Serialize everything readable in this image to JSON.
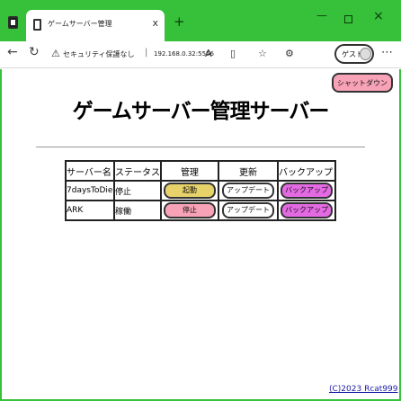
{
  "browser": {
    "tab_title": "ゲームサーバー管理",
    "tab_close": "x",
    "new_tab": "+",
    "window_controls": {
      "minimize": "—",
      "close": "×"
    },
    "address": {
      "security_warning": "セキュリティ保護なし",
      "separator": "|",
      "url": "192.168.0.32:5556"
    },
    "profile_label": "ゲスト",
    "icons": [
      "back-arrow",
      "reload",
      "warning",
      "read-aloud",
      "split-screen",
      "favorites",
      "extensions",
      "more"
    ]
  },
  "page": {
    "shutdown_label": "シャットダウン",
    "title": "ゲームサーバー管理サーバー",
    "table": {
      "headers": [
        "サーバー名",
        "ステータス",
        "管理",
        "更新",
        "バックアップ"
      ],
      "rows": [
        {
          "name": "7daysToDie",
          "status": "停止",
          "manage": "起動",
          "update": "アップデート",
          "backup": "バックアップ",
          "manage_color": "#e7d26a"
        },
        {
          "name": "ARK",
          "status": "稼働",
          "manage": "停止",
          "update": "アップデート",
          "backup": "バックアップ",
          "manage_color": "#f7a2b7"
        }
      ]
    },
    "footer": "(C)2023 Rcat999"
  },
  "colors": {
    "frame_green": "#37c03a",
    "start_yellow": "#e7d26a",
    "stop_pink": "#f7a2b7",
    "backup_magenta": "#e46ae3"
  }
}
